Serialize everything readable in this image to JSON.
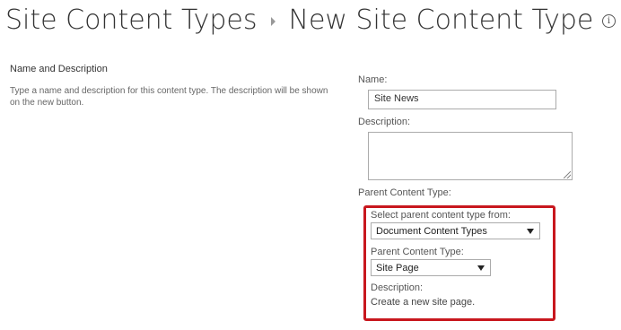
{
  "header": {
    "breadcrumb_root": "Site Content Types",
    "page_title": "New Site Content Type",
    "info_icon": "info-icon"
  },
  "name_and_description": {
    "title": "Name and Description",
    "description": "Type a name and description for this content type. The description will be shown on the new button."
  },
  "form": {
    "name_label": "Name:",
    "name_value": "Site News",
    "description_label": "Description:",
    "description_value": "",
    "parent_content_type_label": "Parent Content Type:"
  },
  "parent_selection": {
    "select_from_label": "Select parent content type from:",
    "select_from_value": "Document Content Types",
    "parent_type_label": "Parent Content Type:",
    "parent_type_value": "Site Page",
    "description_label": "Description:",
    "description_value": "Create a new site page.",
    "highlight_color": "#c8171e"
  }
}
